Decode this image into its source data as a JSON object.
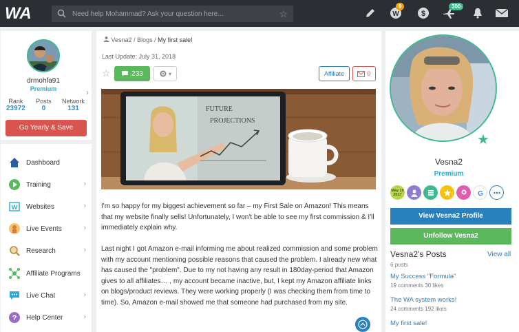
{
  "topbar": {
    "logo": "WA",
    "search_placeholder": "Need help Mohammad? Ask your question here...",
    "icons": [
      "search-icon",
      "star-icon",
      "pencil-icon",
      "notifications-icon",
      "dollar-icon",
      "plane-icon",
      "bell-icon",
      "mail-icon"
    ],
    "notifications_badge": "9",
    "plane_badge": "300"
  },
  "left_profile": {
    "username": "drmohfa91",
    "membership": "Premium",
    "stats": [
      {
        "label": "Rank",
        "value": "23972"
      },
      {
        "label": "Posts",
        "value": "0"
      },
      {
        "label": "Network",
        "value": "131"
      }
    ],
    "cta": "Go Yearly & Save"
  },
  "nav": {
    "items": [
      {
        "label": "Dashboard",
        "icon": "home-icon"
      },
      {
        "label": "Training",
        "icon": "play-icon"
      },
      {
        "label": "Websites",
        "icon": "websites-icon"
      },
      {
        "label": "Live Events",
        "icon": "live-events-icon"
      },
      {
        "label": "Research",
        "icon": "research-icon"
      },
      {
        "label": "Affiliate Programs",
        "icon": "affiliate-icon"
      },
      {
        "label": "Live Chat",
        "icon": "chat-icon"
      },
      {
        "label": "Help Center",
        "icon": "help-icon"
      }
    ]
  },
  "main": {
    "breadcrumb": [
      "Vesna2",
      "Blogs",
      "My first sale!"
    ],
    "last_update": "Last Update: July 31, 2018",
    "comments": "233",
    "affiliate_label": "Affiliate",
    "mail_count": "0",
    "hero_text": [
      "FUTURE",
      "PROJECTIONS"
    ],
    "paragraphs": [
      "I'm so happy for my biggest achievement so far – my First Sale on Amazon! This means that my website finally sells! Unfortunately, I won't be able to see my first commission & I'll immediately explain why.",
      "Last night I got Amazon e-mail informing me about realized commission and some problem with my account mentioning possible reasons that caused the problem. I already new what has caused the \"problem\". Due to my not having any result in 180day-period that Amazon gives to all affiliates… , my account became inactive, but, I kept my Amazon affiliate links on blogs/product reviews. They were working properly (I was checking them from time to time). So, Amazon e-mail showed me that someone had purchased from my site."
    ]
  },
  "right_profile": {
    "name": "Vesna2",
    "membership": "Premium",
    "badge_date": "May 19 2017",
    "view_button": "View Vesna2 Profile",
    "unfollow_button": "Unfollow Vesna2",
    "posts_title": "Vesna2's Posts",
    "view_all": "View all",
    "posts_count": "6 posts",
    "posts": [
      {
        "title": "My Success \"Formula\"",
        "meta": "19 comments   30 likes"
      },
      {
        "title": "The WA system works!",
        "meta": "24 comments   192 likes"
      },
      {
        "title": "My first sale!",
        "meta": ""
      }
    ]
  },
  "colors": {
    "topbar": "#2b2e33",
    "accent_blue": "#2a7fbd",
    "accent_green": "#5cb85c",
    "danger_red": "#d9534f",
    "premium_teal": "#2ea8d5"
  }
}
